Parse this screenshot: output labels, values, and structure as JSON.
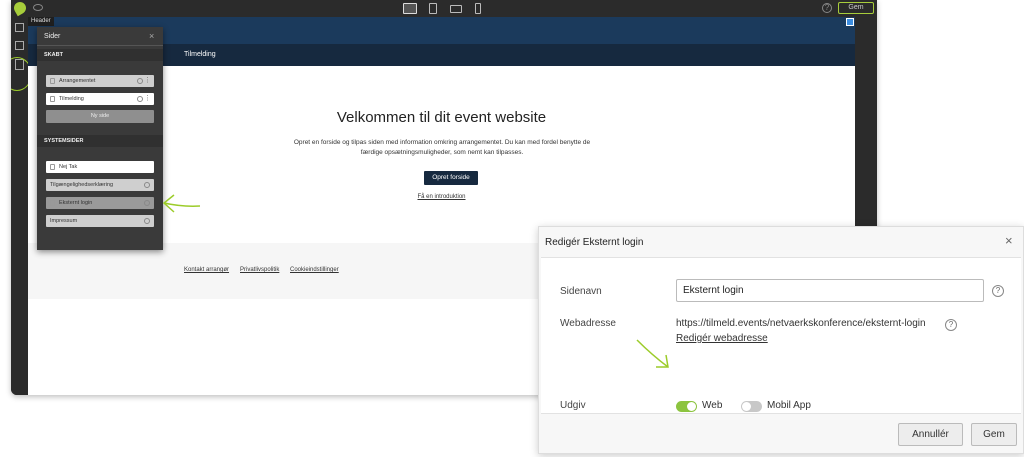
{
  "editor": {
    "header_tag": "Header",
    "save_label": "Gem",
    "help_glyph": "?"
  },
  "site": {
    "nav_item": "Tilmelding",
    "hero_title": "Velkommen til dit event website",
    "hero_text": "Opret en forside og tilpas siden med information omkring arrangementet. Du kan med fordel benytte de færdige opsætningsmuligheder, som nemt kan tilpasses.",
    "cta_label": "Opret forside",
    "intro_link": "Få en introduktion",
    "footer_links": [
      "Kontakt arrangør",
      "Privatlivspolitik",
      "Cookieindstillinger"
    ]
  },
  "sider": {
    "title": "Sider",
    "close_glyph": "×",
    "section_created": "SKABT",
    "created_pages": [
      "Arrangementet",
      "Tilmelding"
    ],
    "new_page_label": "Ny side",
    "section_system": "SYSTEMSIDER",
    "system_pages": [
      "Nej Tak",
      "Tilgængelighedserklæring",
      "Eksternt login",
      "Impressum"
    ]
  },
  "dialog": {
    "title": "Redigér Eksternt login",
    "close_glyph": "×",
    "sidenavn_label": "Sidenavn",
    "sidenavn_value": "Eksternt login",
    "webadresse_label": "Webadresse",
    "webadresse_value": "https://tilmeld.events/netvaerkskonference/eksternt-login",
    "edit_url_link": "Redigér webadresse",
    "udgiv_label": "Udgiv",
    "toggle_web_label": "Web",
    "toggle_web_on": true,
    "toggle_app_label": "Mobil App",
    "toggle_app_on": false,
    "cancel_label": "Annullér",
    "save_label": "Gem",
    "help_glyph": "?"
  },
  "colors": {
    "accent_green": "#8cc43f",
    "site_header": "#1b3a5c",
    "site_nav": "#16293f",
    "editor_dark": "#2b2b2b"
  }
}
